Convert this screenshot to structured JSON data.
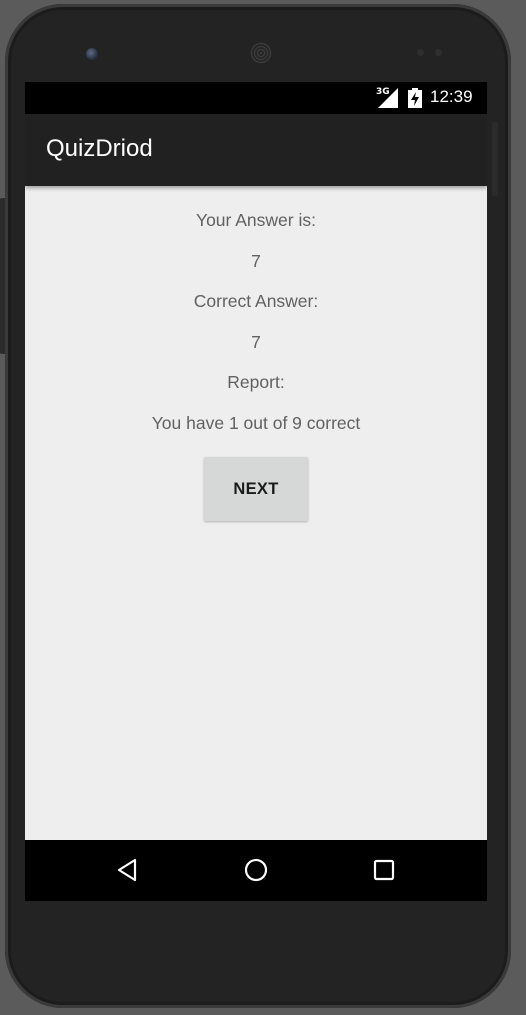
{
  "status_bar": {
    "network": "3G",
    "time": "12:39"
  },
  "app_bar": {
    "title": "QuizDriod"
  },
  "result": {
    "your_answer_label": "Your Answer is:",
    "your_answer_value": "7",
    "correct_answer_label": "Correct Answer:",
    "correct_answer_value": "7",
    "report_label": "Report:",
    "report_text": "You have 1 out of 9 correct"
  },
  "actions": {
    "next_label": "NEXT"
  },
  "nav_bar": {
    "icons": [
      "back-icon",
      "home-icon",
      "recent-apps-icon"
    ]
  },
  "colors": {
    "app_bar": "#212121",
    "background": "#eeeeee",
    "text": "#616161",
    "button": "#d6d7d7"
  }
}
